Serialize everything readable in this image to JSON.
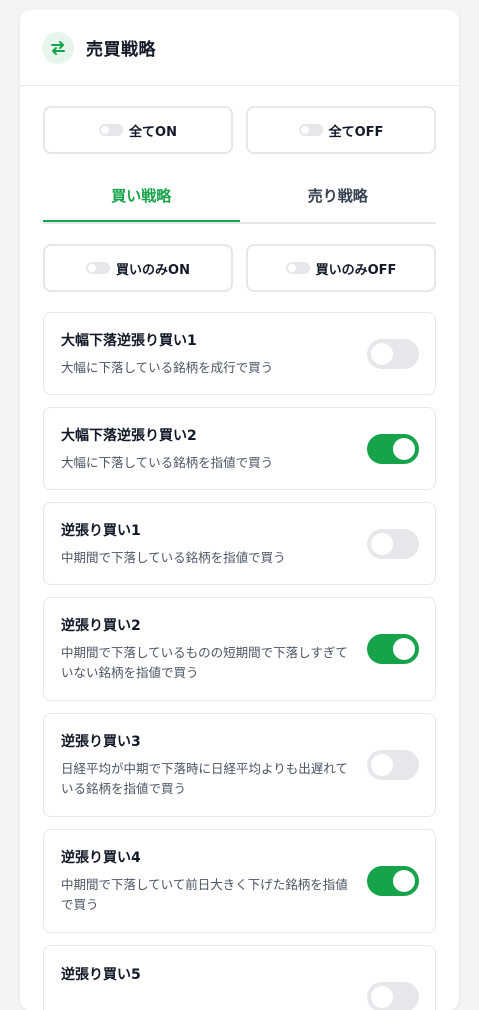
{
  "header": {
    "title": "売買戦略",
    "icon": "swap-arrows-icon",
    "accent": "#16a34a"
  },
  "global_buttons": {
    "all_on": "全てON",
    "all_off": "全てOFF"
  },
  "tabs": [
    {
      "label": "買い戦略",
      "active": true
    },
    {
      "label": "売り戦略",
      "active": false
    }
  ],
  "buy_buttons": {
    "on": "買いのみON",
    "off": "買いのみOFF"
  },
  "strategies": [
    {
      "title": "大幅下落逆張り買い1",
      "desc": "大幅に下落している銘柄を成行で買う",
      "enabled": false
    },
    {
      "title": "大幅下落逆張り買い2",
      "desc": "大幅に下落している銘柄を指値で買う",
      "enabled": true
    },
    {
      "title": "逆張り買い1",
      "desc": "中期間で下落している銘柄を指値で買う",
      "enabled": false
    },
    {
      "title": "逆張り買い2",
      "desc": "中期間で下落しているものの短期間で下落しすぎていない銘柄を指値で買う",
      "enabled": true
    },
    {
      "title": "逆張り買い3",
      "desc": "日経平均が中期で下落時に日経平均よりも出遅れている銘柄を指値で買う",
      "enabled": false
    },
    {
      "title": "逆張り買い4",
      "desc": "中期間で下落していて前日大きく下げた銘柄を指値で買う",
      "enabled": true
    },
    {
      "title": "逆張り買い5",
      "desc": "",
      "enabled": false
    }
  ]
}
